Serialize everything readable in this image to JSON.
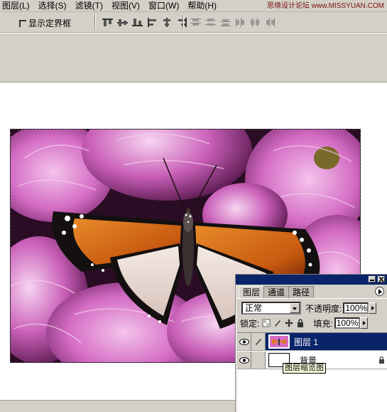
{
  "menubar": {
    "items": [
      "图层(L)",
      "选择(S)",
      "滤镜(T)",
      "视图(V)",
      "窗口(W)",
      "帮助(H)"
    ]
  },
  "watermark": "思缘设计论坛 www.MISSYUAN.COM",
  "options": {
    "show_bounding_box_label": "显示定界框",
    "show_bounding_box_checked": false
  },
  "layers_panel": {
    "tabs": [
      "图层",
      "通道",
      "路径"
    ],
    "active_tab": "图层",
    "blend_mode": "正常",
    "opacity_label": "不透明度:",
    "opacity_value": "100%",
    "lock_label": "锁定:",
    "fill_label": "填充:",
    "fill_value": "100%",
    "layers": [
      {
        "name": "图层 1",
        "selected": true,
        "visible": true
      },
      {
        "name": "背景",
        "selected": false,
        "visible": true,
        "locked": true
      }
    ],
    "tooltip": "图层缩览图"
  },
  "colors": {
    "title_bar": "#0a246a",
    "chrome": "#d4d0c8",
    "selection": "#0a246a"
  },
  "icons": [
    "eye-icon",
    "brush-icon",
    "move-icon",
    "lock-icon",
    "panel-menu-icon",
    "minimize-icon",
    "close-icon"
  ]
}
